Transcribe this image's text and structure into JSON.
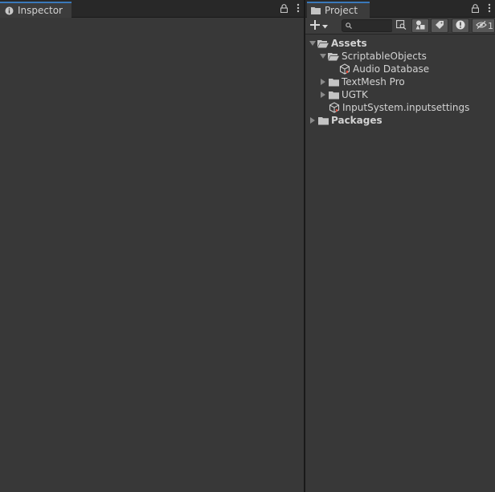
{
  "inspector": {
    "tab_label": "Inspector",
    "tab_icon": "info-icon"
  },
  "project": {
    "tab_label": "Project",
    "tab_icon": "folder-icon",
    "toolbar": {
      "create_icon": "plus-icon",
      "search": {
        "value": "",
        "placeholder": ""
      },
      "hidden_count": "1"
    },
    "tree": [
      {
        "label": "Assets",
        "bold": true,
        "depth": 0,
        "expanded": true,
        "icon": "folder-open-icon"
      },
      {
        "label": "ScriptableObjects",
        "bold": false,
        "depth": 1,
        "expanded": true,
        "icon": "folder-open-icon"
      },
      {
        "label": "Audio Database",
        "bold": false,
        "depth": 2,
        "expanded": null,
        "icon": "scriptable-asset-icon"
      },
      {
        "label": "TextMesh Pro",
        "bold": false,
        "depth": 1,
        "expanded": false,
        "icon": "folder-icon"
      },
      {
        "label": "UGTK",
        "bold": false,
        "depth": 1,
        "expanded": false,
        "icon": "folder-icon"
      },
      {
        "label": "InputSystem.inputsettings",
        "bold": false,
        "depth": 1,
        "expanded": null,
        "icon": "scriptable-asset-icon"
      },
      {
        "label": "Packages",
        "bold": true,
        "depth": 0,
        "expanded": false,
        "icon": "folder-icon"
      }
    ]
  },
  "colors": {
    "panel_bg": "#383838",
    "tab_active_accent": "#3a79bb",
    "text": "#d2d2d2"
  }
}
